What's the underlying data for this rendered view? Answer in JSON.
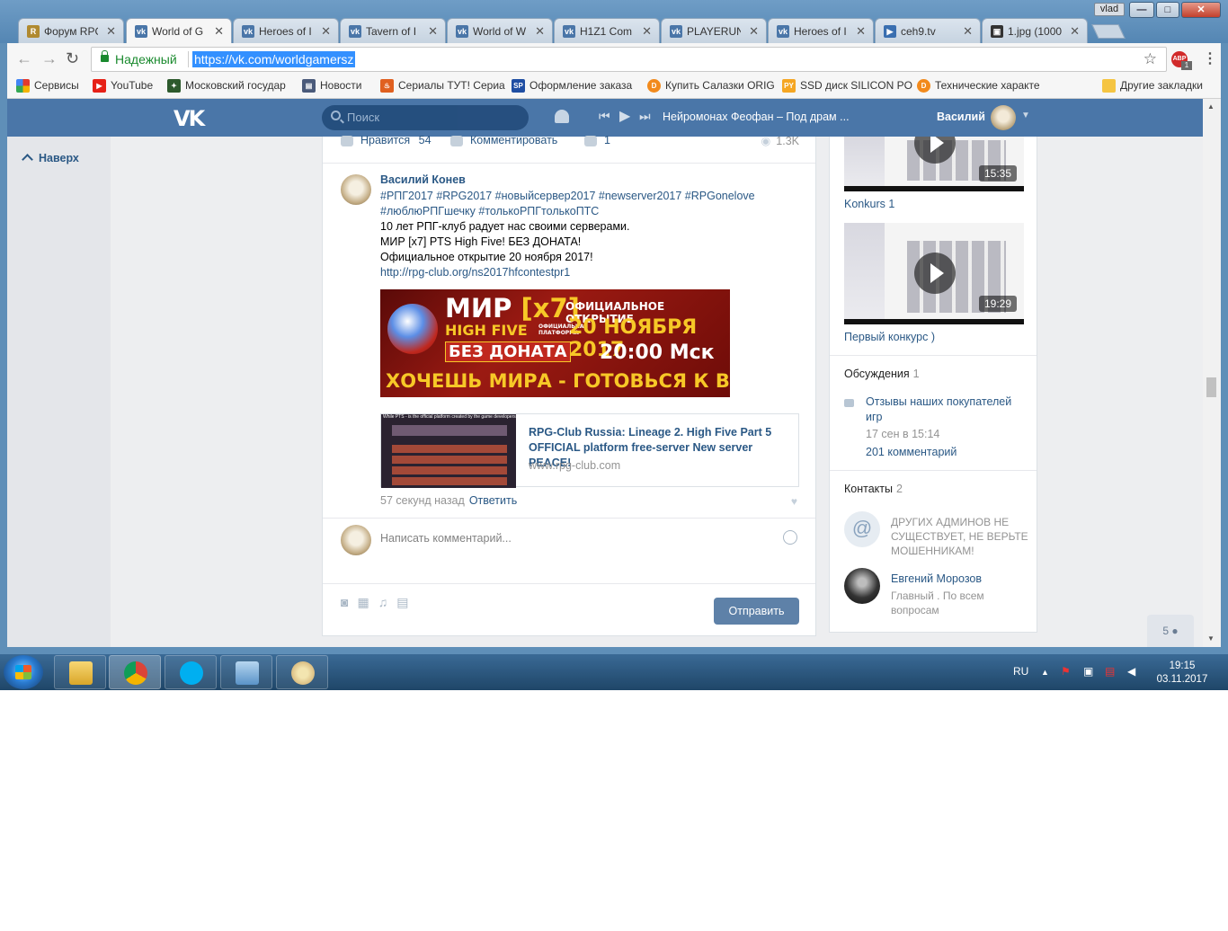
{
  "window": {
    "user_badge": "vlad",
    "controls": {
      "minimize": "—",
      "maximize": "□",
      "close": "✕"
    }
  },
  "tabs": [
    {
      "label": "Форум RPG-",
      "icon": "rpg-club-icon",
      "active": false
    },
    {
      "label": "World of G",
      "icon": "vk-icon",
      "active": true
    },
    {
      "label": "Heroes of I",
      "icon": "vk-icon",
      "active": false
    },
    {
      "label": "Tavern of I",
      "icon": "vk-icon",
      "active": false
    },
    {
      "label": "World of W",
      "icon": "vk-icon",
      "active": false
    },
    {
      "label": "H1Z1 Com",
      "icon": "vk-icon",
      "active": false
    },
    {
      "label": "PLAYERUN",
      "icon": "vk-icon",
      "active": false
    },
    {
      "label": "Heroes of I",
      "icon": "vk-icon",
      "active": false
    },
    {
      "label": "ceh9.tv",
      "icon": "play-icon",
      "active": false
    },
    {
      "label": "1.jpg (1000",
      "icon": "image-icon",
      "active": false
    }
  ],
  "toolbar": {
    "secure_label": "Надежный",
    "url": "https://vk.com/worldgamersz",
    "abp_label": "ABP",
    "abp_count": "1"
  },
  "bookmarks": [
    {
      "label": "Сервисы",
      "icon": "apps-icon",
      "color": "#e33b2e"
    },
    {
      "label": "YouTube",
      "icon": "youtube-icon",
      "color": "#e62117"
    },
    {
      "label": "Московский государ",
      "icon": "emblem-icon",
      "color": "#2d5a2d"
    },
    {
      "label": "Новости",
      "icon": "news-icon",
      "color": "#4a5a7a"
    },
    {
      "label": "Сериалы ТУТ! Сериа",
      "icon": "flame-icon",
      "color": "#e06020"
    },
    {
      "label": "Оформление заказа",
      "icon": "sp-icon",
      "color": "#1f4ea3"
    },
    {
      "label": "Купить Салазки ORIG",
      "icon": "dns-icon",
      "color": "#f28a1c"
    },
    {
      "label": "SSD диск SILICON PO",
      "icon": "py-icon",
      "color": "#f5a623"
    },
    {
      "label": "Технические характе",
      "icon": "dns-icon",
      "color": "#f28a1c"
    },
    {
      "label": "Другие закладки",
      "icon": "folder-icon",
      "color": "#f5c542"
    }
  ],
  "vk": {
    "logo": "VK",
    "search_placeholder": "Поиск",
    "now_playing": "Нейромонах Феофан – Под драм ...",
    "user_name": "Василий",
    "up_label": "Наверх"
  },
  "post": {
    "likes_label": "Нравится",
    "likes_count": "54",
    "comment_label": "Комментировать",
    "shares_count": "1",
    "views": "1.3K",
    "author": "Василий Конев",
    "hashtags": "#РПГ2017 #RPG2017 #новыйсервер2017 #newserver2017 #RPGonelove #люблюРПГшечку #толькоРПГтолькоПТС",
    "line1": "10 лет РПГ-клуб радует нас своими серверами.",
    "line2": "МИР [x7] PTS High Five! БЕЗ ДОНАТА!",
    "line3": "Официальное открытие 20 ноября 2017!",
    "link": "http://rpg-club.org/ns2017hfcontestpr1",
    "banner": {
      "mir": "МИР",
      "x7": "[x7]",
      "high_five": "HIGH FIVE",
      "platform": "ОФИЦИАЛЬНАЯ ПЛАТФОРМА",
      "no_donate": "БЕЗ ДОНАТА",
      "opening": "ОФИЦИАЛЬНОЕ ОТКРЫТИЕ",
      "date": "20 НОЯБРЯ 2017",
      "time": "20:00 Мск",
      "slogan": "ХОЧЕШЬ МИРА - ГОТОВЬСЯ К ВОЙНЕ"
    },
    "card": {
      "thumb_caption": "While PTS - is the official platform created by the game developers",
      "title": "RPG-Club Russia: Lineage 2. High Five Part 5 OFFICIAL platform free-server New server PEACE!",
      "domain": "www.rpg-club.com"
    },
    "time": "57 секунд назад",
    "reply": "Ответить",
    "comment_placeholder": "Написать комментарий...",
    "send": "Отправить"
  },
  "sidebar": {
    "videos": [
      {
        "duration": "15:35",
        "title": "Konkurs 1"
      },
      {
        "duration": "19:29",
        "title": "Первый конкурс )"
      }
    ],
    "discussions": {
      "label": "Обсуждения",
      "count": "1",
      "topic": "Отзывы наших покупателей игр",
      "date": "17 сен в 15:14",
      "comments": "201 комментарий"
    },
    "contacts": {
      "label": "Контакты",
      "count": "2",
      "items": [
        {
          "name": "",
          "desc": "ДРУГИХ АДМИНОВ НЕ СУЩЕСТВУЕТ, НЕ ВЕРЬТЕ МОШЕННИКАМ!",
          "avatar": "at-icon"
        },
        {
          "name": "Евгений Морозов",
          "desc": "Главный . По всем вопросам",
          "avatar": "person"
        }
      ]
    }
  },
  "online_count": "5",
  "taskbar": {
    "lang": "RU",
    "time": "19:15",
    "date": "03.11.2017",
    "apps": [
      "explorer-icon",
      "chrome-icon",
      "skype-icon",
      "notepad-icon",
      "paint-icon"
    ]
  }
}
